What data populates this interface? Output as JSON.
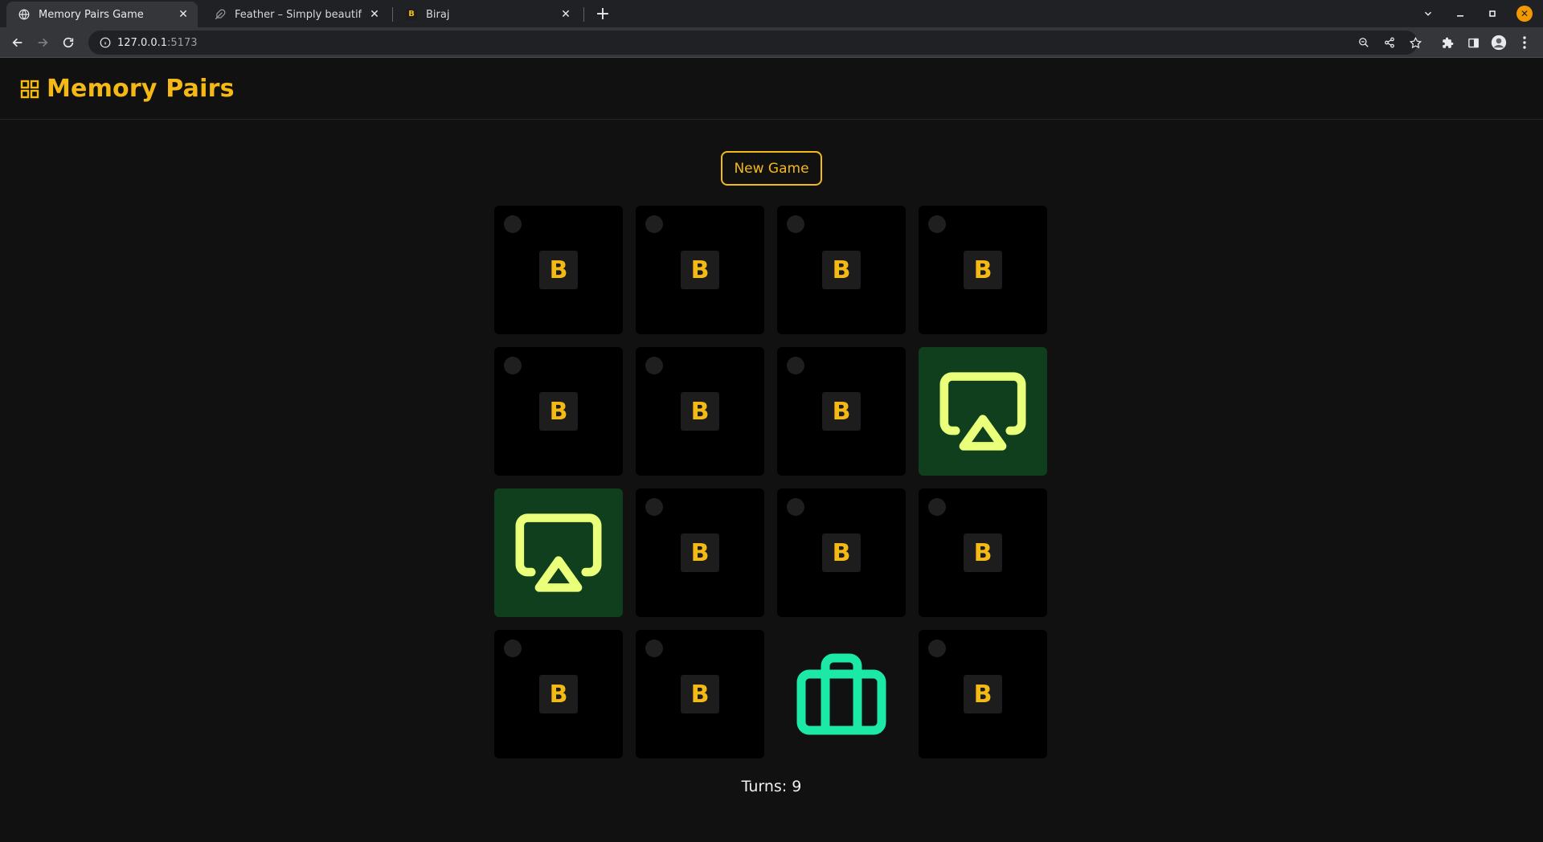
{
  "browser": {
    "tabs": [
      {
        "title": "Memory Pairs Game",
        "active": true
      },
      {
        "title": "Feather – Simply beautiful op",
        "active": false
      },
      {
        "title": "Biraj",
        "active": false
      }
    ],
    "address": {
      "host": "127.0.0.1",
      "port": ":5173"
    },
    "colors": {
      "profile_badge": "#f29900"
    }
  },
  "app": {
    "title": "Memory Pairs",
    "new_game_label": "New Game",
    "turns_label": "Turns:",
    "turns_value": "9",
    "colors": {
      "accent": "#f5b916",
      "matched_bg": "#0f3f1c",
      "airplay_icon": "#eaff7a",
      "briefcase_icon": "#1de9a6"
    }
  },
  "cards": [
    {
      "state": "hidden",
      "face": "B"
    },
    {
      "state": "hidden",
      "face": "B"
    },
    {
      "state": "hidden",
      "face": "B"
    },
    {
      "state": "hidden",
      "face": "B"
    },
    {
      "state": "hidden",
      "face": "B"
    },
    {
      "state": "hidden",
      "face": "B"
    },
    {
      "state": "hidden",
      "face": "B"
    },
    {
      "state": "revealed",
      "icon": "airplay-icon"
    },
    {
      "state": "revealed",
      "icon": "airplay-icon"
    },
    {
      "state": "hidden",
      "face": "B"
    },
    {
      "state": "hidden",
      "face": "B"
    },
    {
      "state": "hidden",
      "face": "B"
    },
    {
      "state": "hidden",
      "face": "B"
    },
    {
      "state": "hidden",
      "face": "B"
    },
    {
      "state": "revealed",
      "icon": "briefcase-icon"
    },
    {
      "state": "hidden",
      "face": "B"
    }
  ]
}
